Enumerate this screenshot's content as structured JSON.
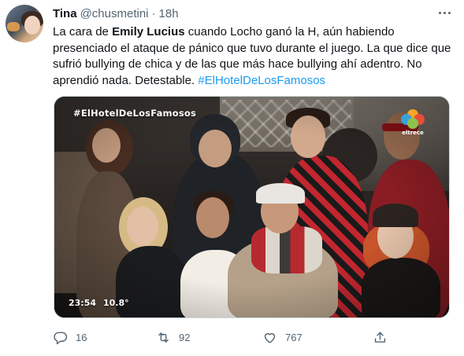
{
  "tweet": {
    "author_name": "Tina",
    "author_handle": "@chusmetini",
    "separator": "·",
    "time": "18h",
    "text_parts": {
      "p1": "La cara de ",
      "bold": "Emily Lucius",
      "p2": " cuando Locho ganó la H, aún habiendo presenciado el ataque de pánico que tuvo durante el juego. La que dice que sufrió bullying de chica y de las que más hace bullying ahí adentro. No aprendió nada. Detestable. ",
      "hashtag": "#ElHotelDeLosFamosos"
    },
    "more_icon": "more-horizontal-icon"
  },
  "media": {
    "overlay_hashtag": "#ElHotelDeLosFamosos",
    "overlay_time": "23:54",
    "overlay_temp": "10.8°",
    "channel_logo_text": "eltrece",
    "logo_colors": [
      "#f5a623",
      "#e94c3b",
      "#3aa0d8",
      "#8bc34a"
    ]
  },
  "actions": {
    "reply": {
      "icon": "reply-icon",
      "count": "16"
    },
    "retweet": {
      "icon": "retweet-icon",
      "count": "92"
    },
    "like": {
      "icon": "heart-icon",
      "count": "767"
    },
    "share": {
      "icon": "share-icon"
    }
  },
  "colors": {
    "accent": "#1d9bf0",
    "secondary_text": "#536471",
    "primary_text": "#0f1419"
  }
}
